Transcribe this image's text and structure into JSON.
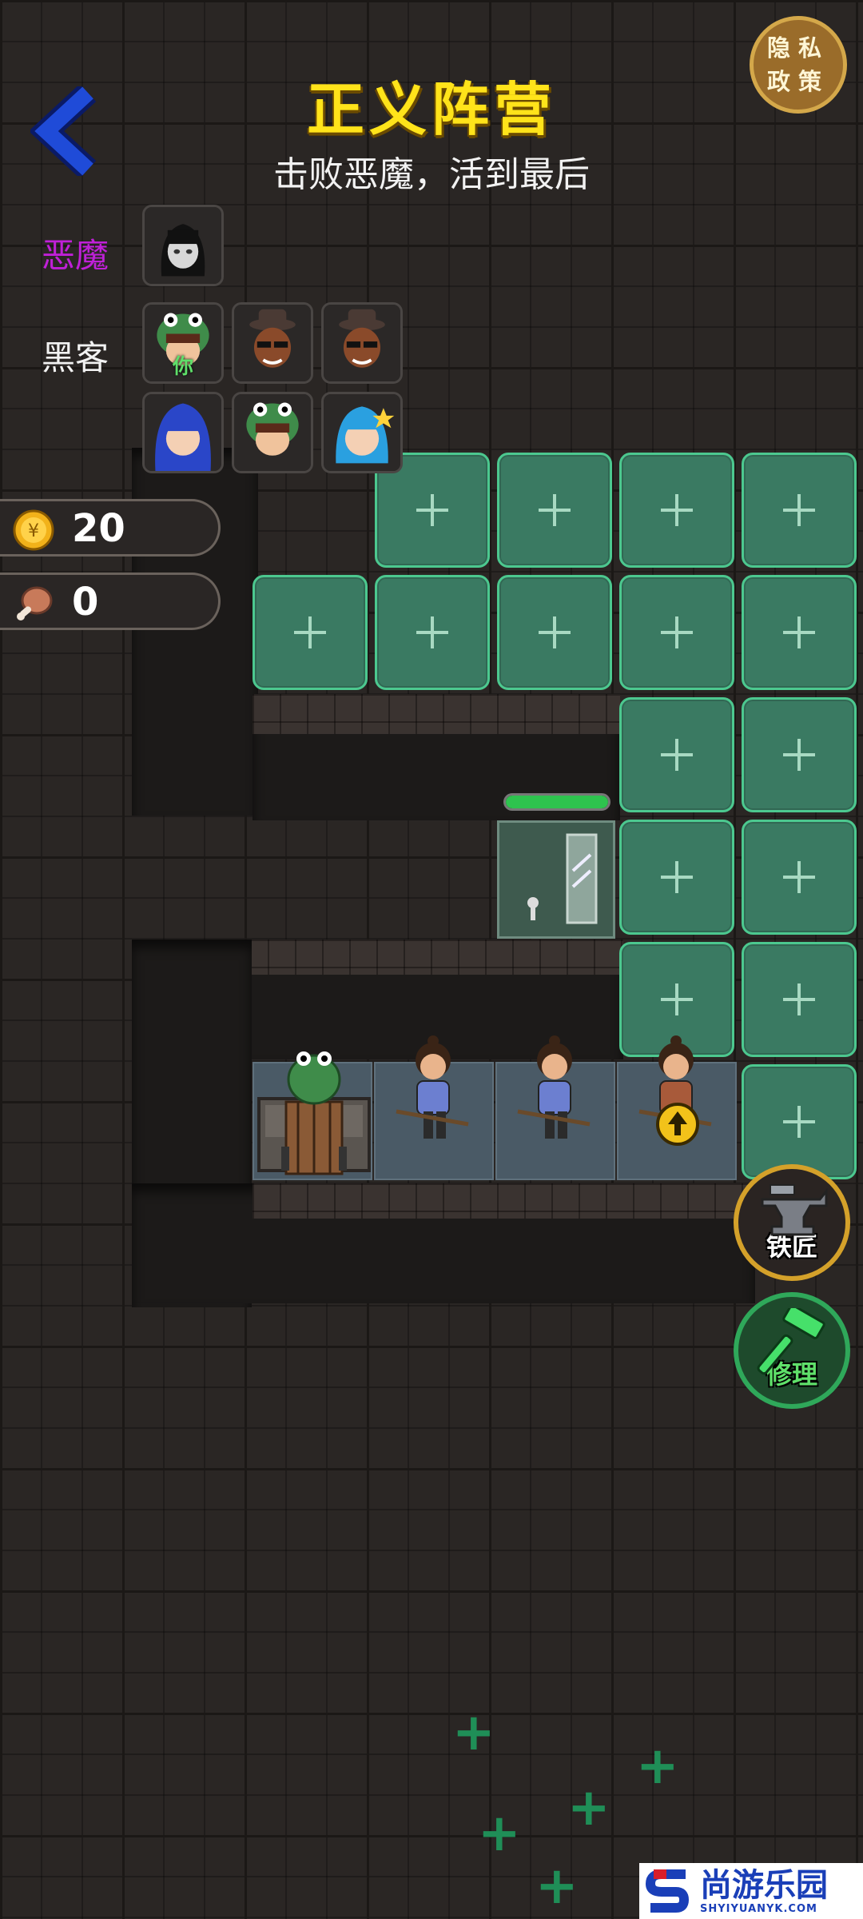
{
  "header": {
    "title": "正义阵营",
    "subtitle": "击败恶魔，活到最后"
  },
  "privacy_button": {
    "line1": "隐私",
    "line2": "政策"
  },
  "roles": {
    "demon_label": "恶魔",
    "hacker_label": "黑客",
    "you_tag": "你",
    "demon_color": "#c020d8"
  },
  "resources": {
    "gold": "20",
    "meat": "0"
  },
  "door": {
    "hp_percent": 100
  },
  "actions": {
    "blacksmith": "铁匠",
    "repair": "修理"
  },
  "watermark": {
    "brand": "尚游乐园",
    "url": "SHYIYUANYK.COM"
  },
  "colors": {
    "title": "#ffe31a",
    "slot": "#3a7a62",
    "slot_border": "#4cc88f",
    "accent_blue": "#1f4bd8"
  }
}
